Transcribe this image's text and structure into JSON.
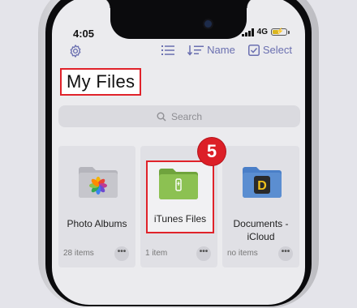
{
  "status_bar": {
    "time": "4:05",
    "network": "4G"
  },
  "toolbar": {
    "sort_label": "Name",
    "select_label": "Select"
  },
  "page": {
    "title": "My Files"
  },
  "search": {
    "placeholder": "Search"
  },
  "files": [
    {
      "name": "Photo Albums",
      "meta": "28 items",
      "folder_color": "#b9b9c0"
    },
    {
      "name": "iTunes Files",
      "meta": "1 item",
      "folder_color": "#7fb24a"
    },
    {
      "name_line1": "Documents -",
      "name_line2": "iCloud",
      "meta": "no items",
      "folder_color": "#5b8ed1"
    }
  ],
  "overlay": {
    "step_number": "5"
  },
  "colors": {
    "accent": "#6a6fb0",
    "highlight": "#e0222a"
  }
}
